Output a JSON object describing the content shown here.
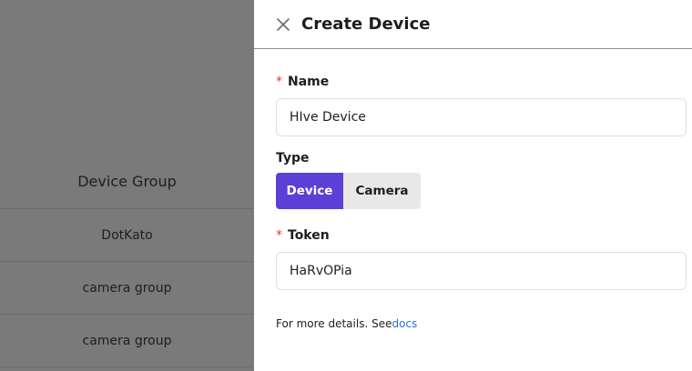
{
  "background": {
    "column_header": "Device Group",
    "rows": [
      "DotKato",
      "camera group",
      "camera group"
    ]
  },
  "drawer": {
    "title": "Create Device",
    "close_icon": "close-icon",
    "name": {
      "label": "Name",
      "required_mark": "*",
      "value": "HIve Device"
    },
    "type": {
      "label": "Type",
      "options": [
        "Device",
        "Camera"
      ],
      "selected": "Device"
    },
    "token": {
      "label": "Token",
      "required_mark": "*",
      "value": "HaRvOPia"
    },
    "hint": {
      "text": "For more details. See",
      "link_text": "docs"
    }
  },
  "colors": {
    "accent": "#5b3fd6",
    "link": "#2f6fdc",
    "required": "#e53935",
    "overlay": "#7a7a7a"
  }
}
